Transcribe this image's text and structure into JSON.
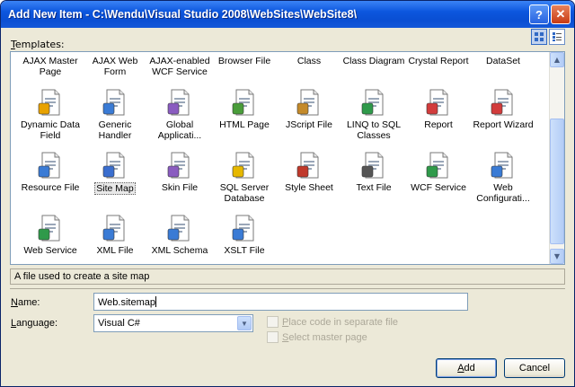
{
  "window": {
    "title": "Add New Item - C:\\Wendu\\Visual Studio 2008\\WebSites\\WebSite8\\",
    "help_glyph": "?",
    "close_glyph": "✕"
  },
  "templates_label": {
    "mnemonic": "T",
    "rest": "emplates:"
  },
  "view_buttons": [
    "large-icons-icon",
    "small-icons-icon"
  ],
  "top_row": [
    {
      "label": "AJAX Master\nPage"
    },
    {
      "label": "AJAX Web\nForm"
    },
    {
      "label": "AJAX-enabled\nWCF Service"
    },
    {
      "label": "Browser File"
    },
    {
      "label": "Class"
    },
    {
      "label": "Class Diagram"
    },
    {
      "label": "Crystal Report"
    },
    {
      "label": "DataSet"
    }
  ],
  "templates": [
    {
      "label": "Dynamic Data\nField",
      "icon": "dynamic-data-field-icon",
      "color": "#e8a200"
    },
    {
      "label": "Generic\nHandler",
      "icon": "generic-handler-icon",
      "color": "#3a7bd5"
    },
    {
      "label": "Global\nApplicati...",
      "icon": "global-application-icon",
      "color": "#8a5cc0"
    },
    {
      "label": "HTML Page",
      "icon": "html-page-icon",
      "color": "#4a9d3a"
    },
    {
      "label": "JScript File",
      "icon": "jscript-file-icon",
      "color": "#c48a2a"
    },
    {
      "label": "LINQ to SQL\nClasses",
      "icon": "linq-to-sql-icon",
      "color": "#2f9a4a"
    },
    {
      "label": "Report",
      "icon": "report-icon",
      "color": "#d23c3c"
    },
    {
      "label": "Report Wizard",
      "icon": "report-wizard-icon",
      "color": "#d23c3c"
    },
    {
      "label": "Resource File",
      "icon": "resource-file-icon",
      "color": "#3a7bd5"
    },
    {
      "label": "Site Map",
      "icon": "site-map-icon",
      "color": "#3a6ecf",
      "selected": true
    },
    {
      "label": "Skin File",
      "icon": "skin-file-icon",
      "color": "#8a5cc0"
    },
    {
      "label": "SQL Server\nDatabase",
      "icon": "sql-database-icon",
      "color": "#e6b800"
    },
    {
      "label": "Style Sheet",
      "icon": "style-sheet-icon",
      "color": "#c0392b"
    },
    {
      "label": "Text File",
      "icon": "text-file-icon",
      "color": "#555555"
    },
    {
      "label": "WCF Service",
      "icon": "wcf-service-icon",
      "color": "#2f9a4a"
    },
    {
      "label": "Web\nConfigurati...",
      "icon": "web-config-icon",
      "color": "#3a7bd5"
    },
    {
      "label": "Web Service",
      "icon": "web-service-icon",
      "color": "#2f9a4a"
    },
    {
      "label": "XML File",
      "icon": "xml-file-icon",
      "color": "#3a7bd5"
    },
    {
      "label": "XML Schema",
      "icon": "xml-schema-icon",
      "color": "#3a7bd5"
    },
    {
      "label": "XSLT File",
      "icon": "xslt-file-icon",
      "color": "#3a7bd5"
    }
  ],
  "description": "A file used to create a site map",
  "name_label": {
    "mnemonic": "N",
    "rest": "ame:"
  },
  "name_value": "Web.sitemap",
  "language_label": {
    "mnemonic": "L",
    "rest": "anguage:"
  },
  "language_value": "Visual C#",
  "place_code": {
    "mnemonic": "P",
    "rest": "lace code in separate file"
  },
  "master_page": {
    "mnemonic": "S",
    "rest": "elect master page"
  },
  "buttons": {
    "add": {
      "mnemonic": "A",
      "rest": "dd"
    },
    "cancel": "Cancel"
  }
}
